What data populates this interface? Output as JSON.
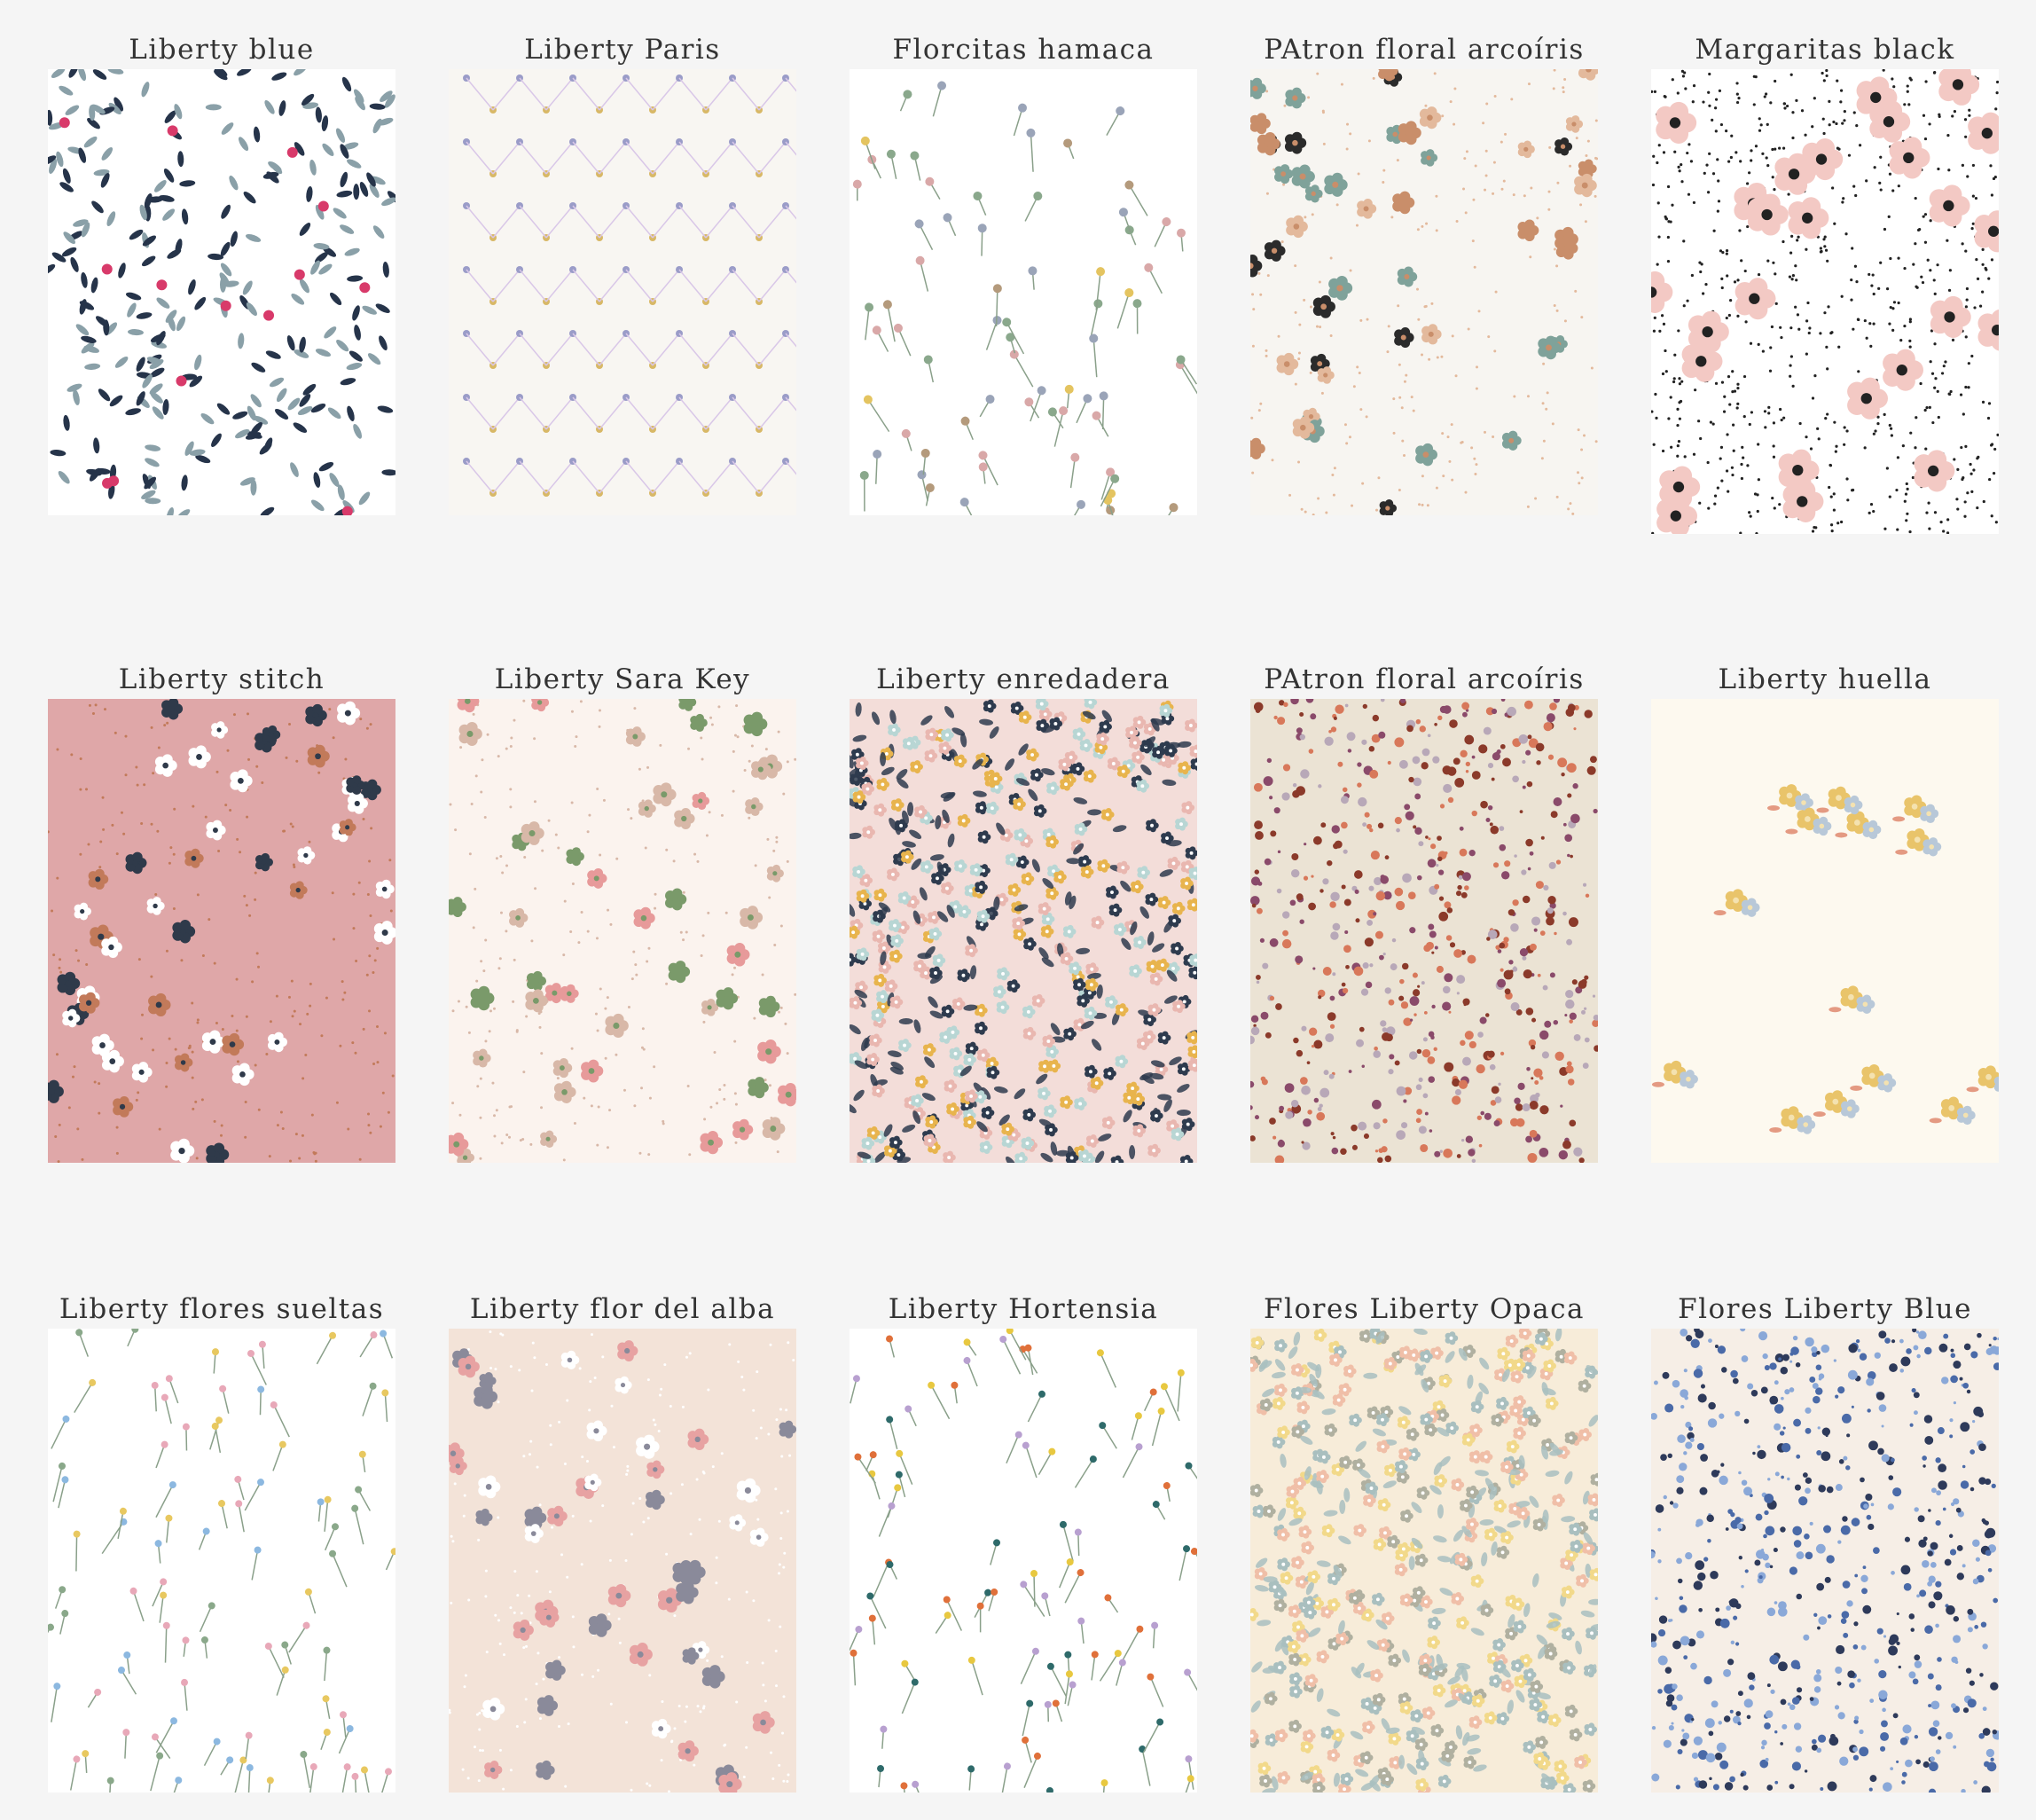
{
  "gallery": {
    "items": [
      {
        "title": "Liberty blue",
        "bg": "#ffffff",
        "motif": "leaf",
        "colors": [
          "#26344a",
          "#8aa0a8",
          "#d83a6a",
          "#111111"
        ]
      },
      {
        "title": "Liberty Paris",
        "bg": "#f8f6f2",
        "motif": "lattice",
        "colors": [
          "#9a9cc8",
          "#d8b866",
          "#d9c7e8"
        ]
      },
      {
        "title": "Florcitas hamaca",
        "bg": "#ffffff",
        "motif": "sprig",
        "colors": [
          "#9aa4b8",
          "#b49a7c",
          "#d9a8a8",
          "#e4c460",
          "#8aa88c"
        ]
      },
      {
        "title": "PAtron floral arcoíris",
        "bg": "#f7f5f1",
        "motif": "flower",
        "colors": [
          "#2b2b2b",
          "#c98e6a",
          "#7fa29a",
          "#e3b99c"
        ]
      },
      {
        "title": "Margaritas black",
        "bg": "#ffffff",
        "motif": "daisy",
        "colors": [
          "#f3c9c4",
          "#222222"
        ]
      },
      {
        "title": "Liberty stitch",
        "bg": "#dfa7a8",
        "motif": "flower",
        "colors": [
          "#ffffff",
          "#2f3a4a",
          "#c27a5a"
        ]
      },
      {
        "title": "Liberty Sara Key",
        "bg": "#fbf3ee",
        "motif": "flower",
        "colors": [
          "#e79a9a",
          "#7a9a6a",
          "#d8b8a8"
        ]
      },
      {
        "title": "Liberty enredadera",
        "bg": "#f3ddd9",
        "motif": "dense",
        "colors": [
          "#b8d6d4",
          "#2e3b4e",
          "#e8b44d",
          "#e9b7b0"
        ]
      },
      {
        "title": "PAtron floral arcoíris",
        "bg": "#ebe3d4",
        "motif": "speckle",
        "colors": [
          "#8b3a2a",
          "#8a4a6a",
          "#b8a8b8",
          "#d8785a"
        ]
      },
      {
        "title": "Liberty huella",
        "bg": "#fdf9ef",
        "motif": "bouquet",
        "colors": [
          "#e9c46a",
          "#b8c8d8",
          "#e49a82"
        ]
      },
      {
        "title": "Liberty flores sueltas",
        "bg": "#ffffff",
        "motif": "stem",
        "colors": [
          "#8cb8e0",
          "#e8a8b8",
          "#e8c860",
          "#8aa88a"
        ]
      },
      {
        "title": "Liberty flor del alba",
        "bg": "#f3e3d8",
        "motif": "flower",
        "colors": [
          "#e7a2a2",
          "#8a8a9a",
          "#ffffff"
        ]
      },
      {
        "title": "Liberty Hortensia",
        "bg": "#ffffff",
        "motif": "stem",
        "colors": [
          "#e0703a",
          "#b8a0d0",
          "#e8c840",
          "#2e6a6a"
        ]
      },
      {
        "title": "Flores Liberty Opaca",
        "bg": "#f7ecd9",
        "motif": "dense",
        "colors": [
          "#f0bfa8",
          "#a9bfbf",
          "#f2d98a",
          "#b0b0a0"
        ]
      },
      {
        "title": "Flores Liberty Blue",
        "bg": "#f6eee6",
        "motif": "speckle",
        "colors": [
          "#4a6aa8",
          "#8aa8d8",
          "#2e3a5a"
        ]
      }
    ]
  }
}
